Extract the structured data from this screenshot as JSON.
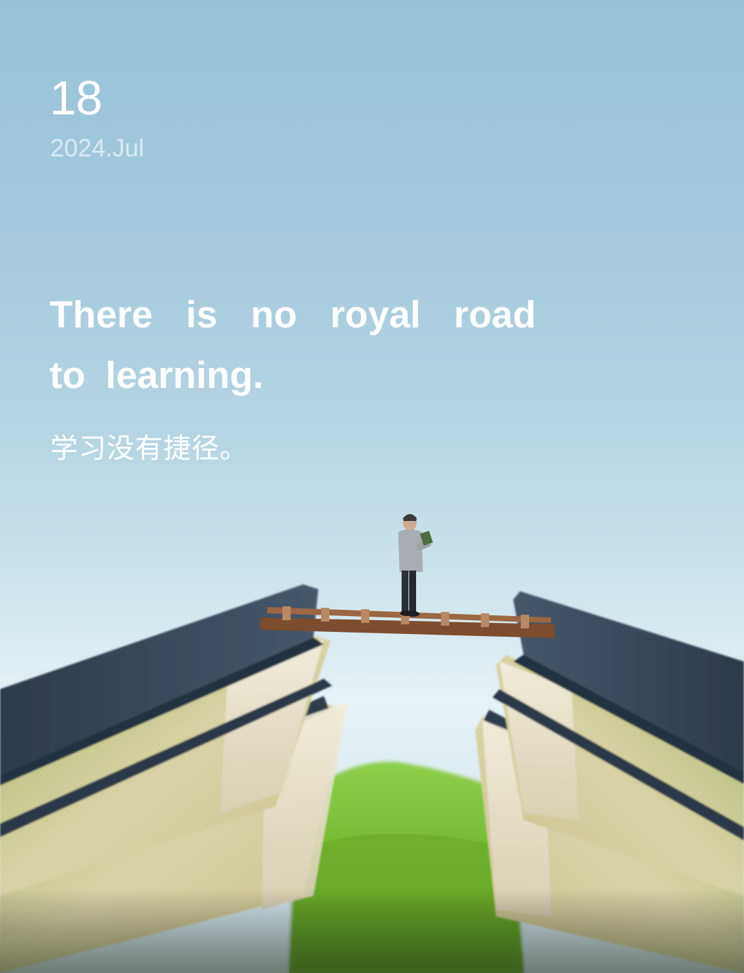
{
  "calendar": {
    "day": "18",
    "date": "2024.Jul"
  },
  "quote": {
    "english": "There is no royal road to learning.",
    "chinese": "学习没有捷径。"
  },
  "palette": {
    "sky_top": "#97c3d8",
    "sky_bottom": "#e6f2f7",
    "book_cover": "#3b4b5e",
    "book_pages": "#c8c99a",
    "grass": "#74b531",
    "ladder": "#8b5a38",
    "text": "#ffffff"
  }
}
